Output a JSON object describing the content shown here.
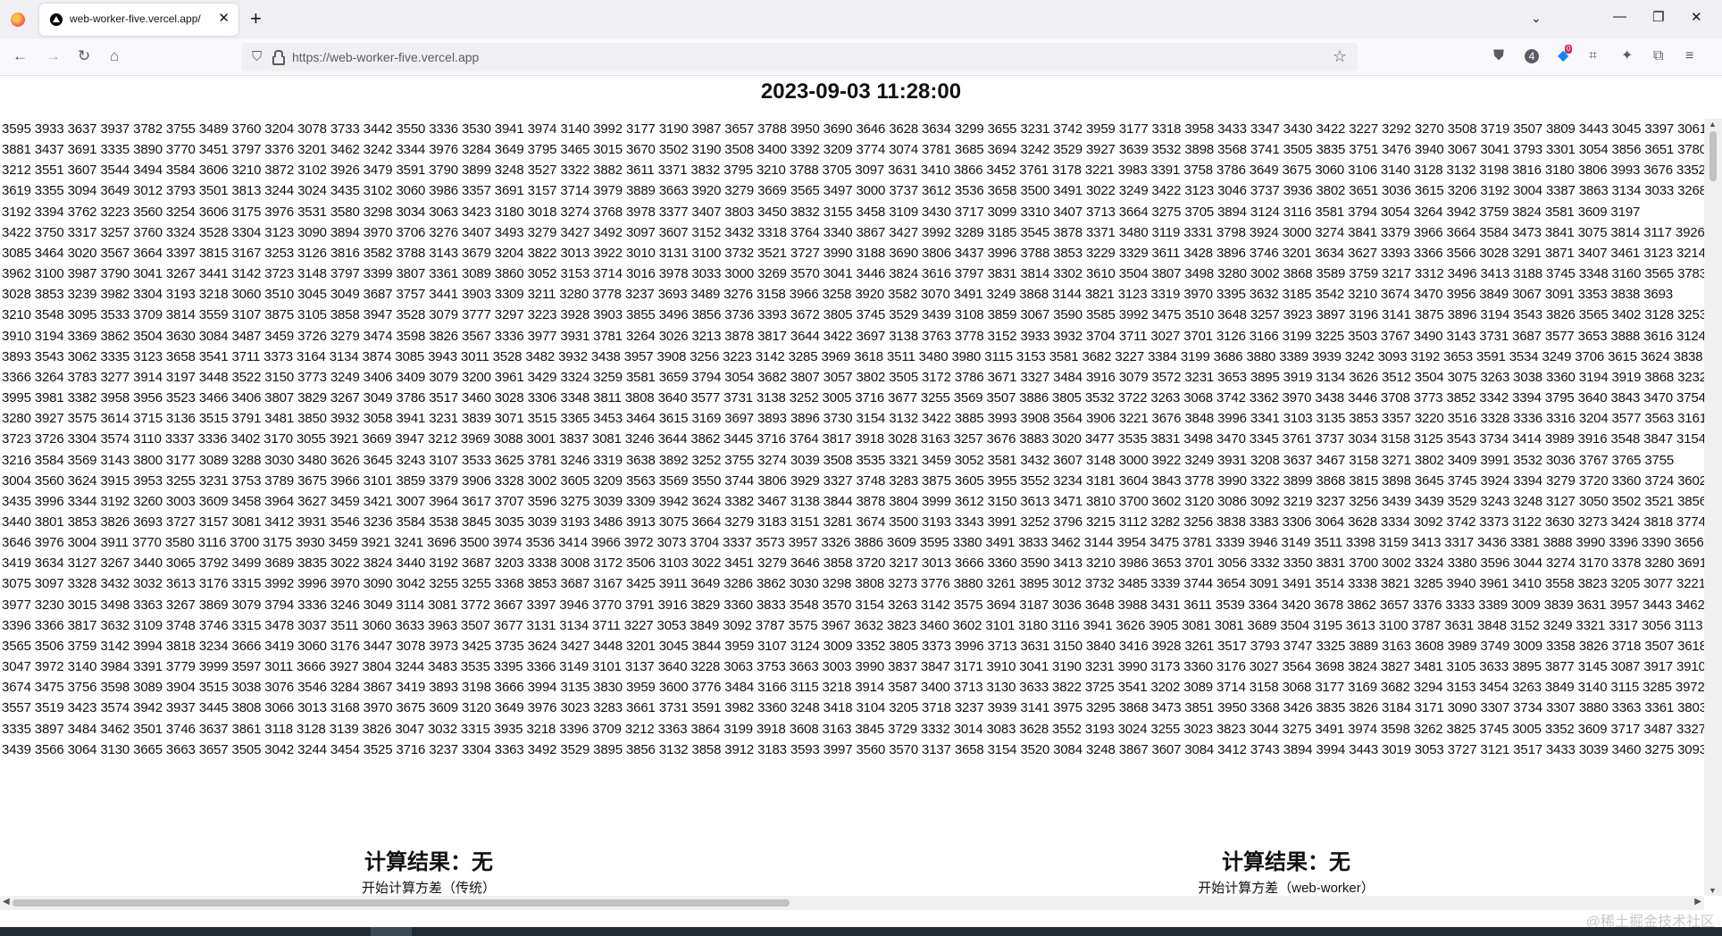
{
  "browser": {
    "tab_title": "web-worker-five.vercel.app/",
    "url": "https://web-worker-five.vercel.app",
    "extension_badge": "0",
    "account_badge": "4"
  },
  "page": {
    "clock": "2023-09-03 11:28:00",
    "numbers_text": "3595 3933 3637 3937 3782 3755 3489 3760 3204 3078 3733 3442 3550 3336 3530 3941 3974 3140 3992 3177 3190 3987 3657 3788 3950 3690 3646 3628 3634 3299 3655 3231 3742 3959 3177 3318 3958 3433 3347 3430 3422 3227 3292 3270 3508 3719 3507 3809 3443 3045 3397 3061\n3881 3437 3691 3335 3890 3770 3451 3797 3376 3201 3462 3242 3344 3976 3284 3649 3795 3465 3015 3670 3502 3190 3508 3400 3392 3209 3774 3074 3781 3685 3694 3242 3529 3927 3639 3532 3898 3568 3741 3505 3835 3751 3476 3940 3067 3041 3793 3301 3054 3856 3651 3780\n3212 3551 3607 3544 3494 3584 3606 3210 3872 3102 3926 3479 3591 3790 3899 3248 3527 3322 3882 3611 3371 3832 3795 3210 3788 3705 3097 3631 3410 3866 3452 3761 3178 3221 3983 3391 3758 3786 3649 3675 3060 3106 3140 3128 3132 3198 3816 3180 3806 3993 3676 3352\n3619 3355 3094 3649 3012 3793 3501 3813 3244 3024 3435 3102 3060 3986 3357 3691 3157 3714 3979 3889 3663 3920 3279 3669 3565 3497 3000 3737 3612 3536 3658 3500 3491 3022 3249 3422 3123 3046 3737 3936 3802 3651 3036 3615 3206 3192 3004 3387 3863 3134 3033 3268\n3192 3394 3762 3223 3560 3254 3606 3175 3976 3531 3580 3298 3034 3063 3423 3180 3018 3274 3768 3978 3377 3407 3803 3450 3832 3155 3458 3109 3430 3717 3099 3310 3407 3713 3664 3275 3705 3894 3124 3116 3581 3794 3054 3264 3942 3759 3824 3581 3609 3197\n3422 3750 3317 3257 3760 3324 3528 3304 3123 3090 3894 3970 3706 3276 3407 3493 3279 3427 3492 3097 3607 3152 3432 3318 3764 3340 3867 3427 3992 3289 3185 3545 3878 3371 3480 3119 3331 3798 3924 3000 3274 3841 3379 3966 3664 3584 3473 3841 3075 3814 3117 3926\n3085 3464 3020 3567 3664 3397 3815 3167 3253 3126 3816 3582 3788 3143 3679 3204 3822 3013 3922 3010 3131 3100 3732 3521 3727 3990 3188 3690 3806 3437 3996 3788 3853 3229 3329 3611 3428 3896 3746 3201 3634 3627 3393 3366 3566 3028 3291 3871 3407 3461 3123 3214\n3962 3100 3987 3790 3041 3267 3441 3142 3723 3148 3797 3399 3807 3361 3089 3860 3052 3153 3714 3016 3978 3033 3000 3269 3570 3041 3446 3824 3616 3797 3831 3814 3302 3610 3504 3807 3498 3280 3002 3868 3589 3759 3217 3312 3496 3413 3188 3745 3348 3160 3565 3783\n3028 3853 3239 3982 3304 3193 3218 3060 3510 3045 3049 3687 3757 3441 3903 3309 3211 3280 3778 3237 3693 3489 3276 3158 3966 3258 3920 3582 3070 3491 3249 3868 3144 3821 3123 3319 3970 3395 3632 3185 3542 3210 3674 3470 3956 3849 3067 3091 3353 3838 3693\n3210 3548 3095 3533 3709 3814 3559 3107 3875 3105 3858 3947 3528 3079 3777 3297 3223 3928 3903 3855 3496 3856 3736 3393 3672 3805 3745 3529 3439 3108 3859 3067 3590 3585 3992 3475 3510 3648 3257 3923 3897 3196 3141 3875 3896 3194 3543 3826 3565 3402 3128 3253\n3910 3194 3369 3862 3504 3630 3084 3487 3459 3726 3279 3474 3598 3826 3567 3336 3977 3931 3781 3264 3026 3213 3878 3817 3644 3422 3697 3138 3763 3778 3152 3933 3932 3704 3711 3027 3701 3126 3166 3199 3225 3503 3767 3490 3143 3731 3687 3577 3653 3888 3616 3124\n3893 3543 3062 3335 3123 3658 3541 3711 3373 3164 3134 3874 3085 3943 3011 3528 3482 3932 3438 3957 3908 3256 3223 3142 3285 3969 3618 3511 3480 3980 3115 3153 3581 3682 3227 3384 3199 3686 3880 3389 3939 3242 3093 3192 3653 3591 3534 3249 3706 3615 3624 3838\n3366 3264 3783 3277 3914 3197 3448 3522 3150 3773 3249 3406 3409 3079 3200 3961 3429 3324 3259 3581 3659 3794 3054 3682 3807 3057 3802 3505 3172 3786 3671 3327 3484 3916 3079 3572 3231 3653 3895 3919 3134 3626 3512 3504 3075 3263 3038 3360 3194 3919 3868 3232\n3995 3981 3382 3958 3956 3523 3466 3406 3807 3829 3267 3049 3786 3517 3460 3028 3306 3348 3811 3808 3640 3577 3731 3138 3252 3005 3716 3677 3255 3569 3507 3886 3805 3532 3722 3263 3068 3742 3362 3970 3438 3446 3708 3773 3852 3342 3394 3795 3640 3843 3470 3754\n3280 3927 3575 3614 3715 3136 3515 3791 3481 3850 3932 3058 3941 3231 3839 3071 3515 3365 3453 3464 3615 3169 3697 3893 3896 3730 3154 3132 3422 3885 3993 3908 3564 3906 3221 3676 3848 3996 3341 3103 3135 3853 3357 3220 3516 3328 3336 3316 3204 3577 3563 3161\n3723 3726 3304 3574 3110 3337 3336 3402 3170 3055 3921 3669 3947 3212 3969 3088 3001 3837 3081 3246 3644 3862 3445 3716 3764 3817 3918 3028 3163 3257 3676 3883 3020 3477 3535 3831 3498 3470 3345 3761 3737 3034 3158 3125 3543 3734 3414 3989 3916 3548 3847 3154\n3216 3584 3569 3143 3800 3177 3089 3288 3030 3480 3626 3645 3243 3107 3533 3625 3781 3246 3319 3638 3892 3252 3755 3274 3039 3508 3535 3321 3459 3052 3581 3432 3607 3148 3000 3922 3249 3931 3208 3637 3467 3158 3271 3802 3409 3991 3532 3036 3767 3765 3755\n3004 3560 3624 3915 3953 3255 3231 3753 3789 3675 3966 3101 3859 3379 3906 3328 3002 3605 3209 3563 3569 3550 3744 3806 3929 3327 3748 3283 3875 3605 3955 3552 3234 3181 3604 3843 3778 3990 3322 3899 3868 3815 3898 3645 3745 3924 3394 3279 3720 3360 3724 3602\n3435 3996 3344 3192 3260 3003 3609 3458 3964 3627 3459 3421 3007 3964 3617 3707 3596 3275 3039 3309 3942 3624 3382 3467 3138 3844 3878 3804 3999 3612 3150 3613 3471 3810 3700 3602 3120 3086 3092 3219 3237 3256 3439 3439 3529 3243 3248 3127 3050 3502 3521 3856\n3440 3801 3853 3826 3693 3727 3157 3081 3412 3931 3546 3236 3584 3538 3845 3035 3039 3193 3486 3913 3075 3664 3279 3183 3151 3281 3674 3500 3193 3343 3991 3252 3796 3215 3112 3282 3256 3838 3383 3306 3064 3628 3334 3092 3742 3373 3122 3630 3273 3424 3818 3774\n3646 3976 3004 3911 3770 3580 3116 3700 3175 3930 3459 3921 3241 3696 3500 3974 3536 3414 3966 3972 3073 3704 3337 3573 3957 3326 3886 3609 3595 3380 3491 3833 3462 3144 3954 3475 3781 3339 3946 3149 3511 3398 3159 3413 3317 3436 3381 3888 3990 3396 3390 3656\n3419 3634 3127 3267 3440 3065 3792 3499 3689 3835 3022 3824 3440 3192 3687 3203 3338 3008 3172 3506 3103 3022 3451 3279 3646 3858 3720 3217 3013 3666 3360 3590 3413 3210 3986 3653 3701 3056 3332 3350 3831 3700 3002 3324 3380 3596 3044 3274 3170 3378 3280 3691\n3075 3097 3328 3432 3032 3613 3176 3315 3992 3996 3970 3090 3042 3255 3255 3368 3853 3687 3167 3425 3911 3649 3286 3862 3030 3298 3808 3273 3776 3880 3261 3895 3012 3732 3485 3339 3744 3654 3091 3491 3514 3338 3821 3285 3940 3961 3410 3558 3823 3205 3077 3221\n3977 3230 3015 3498 3363 3267 3869 3079 3794 3336 3246 3049 3114 3081 3772 3667 3397 3946 3770 3791 3916 3829 3360 3833 3548 3570 3154 3263 3142 3575 3694 3187 3036 3648 3988 3431 3611 3539 3364 3420 3678 3862 3657 3376 3333 3389 3009 3839 3631 3957 3443 3462\n3396 3366 3817 3632 3109 3748 3746 3315 3478 3037 3511 3060 3633 3963 3507 3677 3131 3134 3711 3227 3053 3849 3092 3787 3575 3967 3632 3823 3460 3602 3101 3180 3116 3941 3626 3905 3081 3081 3689 3504 3195 3613 3100 3787 3631 3848 3152 3249 3321 3317 3056 3113\n3565 3506 3759 3142 3994 3818 3234 3666 3419 3060 3176 3447 3078 3973 3425 3735 3624 3427 3448 3201 3045 3844 3959 3107 3124 3009 3352 3805 3373 3996 3713 3631 3150 3840 3416 3928 3261 3517 3793 3747 3325 3889 3163 3608 3989 3749 3009 3358 3826 3718 3507 3618\n3047 3972 3140 3984 3391 3779 3999 3597 3011 3666 3927 3804 3244 3483 3535 3395 3366 3149 3101 3137 3640 3228 3063 3753 3663 3003 3990 3837 3847 3171 3910 3041 3190 3231 3990 3173 3360 3176 3027 3564 3698 3824 3827 3481 3105 3633 3895 3877 3145 3087 3917 3910\n3674 3475 3756 3598 3089 3904 3515 3038 3076 3546 3284 3867 3419 3893 3198 3666 3994 3135 3830 3959 3600 3776 3484 3166 3115 3218 3914 3587 3400 3713 3130 3633 3822 3725 3541 3202 3089 3714 3158 3068 3177 3169 3682 3294 3153 3454 3263 3849 3140 3115 3285 3972\n3557 3519 3423 3574 3942 3937 3445 3808 3066 3013 3168 3970 3675 3609 3120 3649 3976 3023 3283 3661 3731 3591 3982 3360 3248 3418 3104 3205 3718 3237 3939 3141 3975 3295 3868 3473 3851 3950 3368 3426 3835 3826 3184 3171 3090 3307 3734 3307 3880 3363 3361 3803\n3335 3897 3484 3462 3501 3746 3637 3861 3118 3128 3139 3826 3047 3032 3315 3935 3218 3396 3709 3212 3363 3864 3199 3918 3608 3163 3845 3729 3332 3014 3083 3628 3552 3193 3024 3255 3023 3823 3044 3275 3491 3974 3598 3262 3825 3745 3005 3352 3609 3717 3487 3327\n3439 3566 3064 3130 3665 3663 3657 3505 3042 3244 3454 3525 3716 3237 3304 3363 3492 3529 3895 3856 3132 3858 3912 3183 3593 3997 3560 3570 3137 3658 3154 3520 3084 3248 3867 3607 3084 3412 3743 3894 3994 3443 3019 3053 3727 3121 3517 3433 3039 3460 3275 3093",
    "result_left_title": "计算结果：无",
    "result_left_button": "开始计算方差（传统）",
    "result_right_title": "计算结果：无",
    "result_right_button": "开始计算方差（web-worker）",
    "watermark": "@稀土掘金技术社区"
  }
}
